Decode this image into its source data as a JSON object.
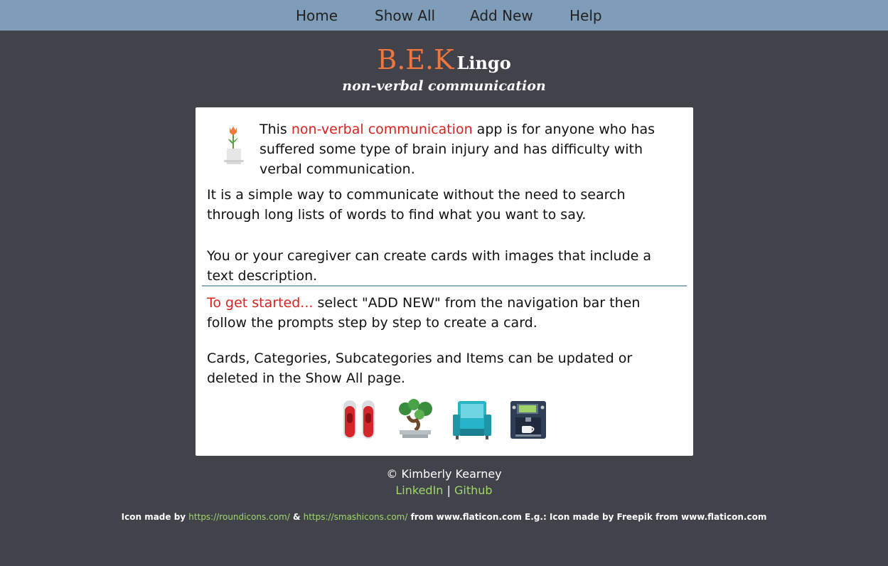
{
  "nav": {
    "home": "Home",
    "show_all": "Show All",
    "add_new": "Add New",
    "help": "Help"
  },
  "brand": {
    "bek": "B.E.K",
    "lingo": "Lingo",
    "tagline": "non-verbal communication"
  },
  "intro": {
    "lead": "This ",
    "highlight": "non-verbal communication",
    "rest_line1": " app is for anyone who has",
    "line2": "suffered some type of brain injury and has difficulty with",
    "line3": "verbal communication."
  },
  "para2": {
    "line1": "It is a simple way to communicate without the need to search",
    "line2": "through long lists of words to find what you want to say."
  },
  "para3": {
    "line1": "You or your caregiver can create cards with images that include a",
    "line2": "text description."
  },
  "started": {
    "highlight": "To get started...",
    "rest_line1": " select \"ADD NEW\" from the navigation bar then",
    "line2": "follow the prompts step by step to create a card."
  },
  "para5": {
    "line1": "Cards, Categories, Subcategories and Items can be updated or",
    "line2": "deleted in the Show All page."
  },
  "icons": [
    "flower-pot-icon",
    "shoes-icon",
    "bonsai-icon",
    "armchair-icon",
    "coffee-machine-icon"
  ],
  "footer": {
    "name": "© Kimberly Kearney",
    "linkedin": "LinkedIn",
    "separator": "|",
    "github": "Github"
  },
  "credits": {
    "prefix": "Icon made by ",
    "link1": "https://roundicons.com/",
    "amp": " & ",
    "link2": "https://smashicons.com/",
    "suffix": " from www.flaticon.com E.g.: Icon made by Freepik from www.flaticon.com"
  },
  "colors": {
    "background": "#41424a",
    "nav": "#7f9db8",
    "accent_orange": "#f0763f",
    "accent_red": "#d9231f",
    "link_green": "#9ed86a"
  }
}
